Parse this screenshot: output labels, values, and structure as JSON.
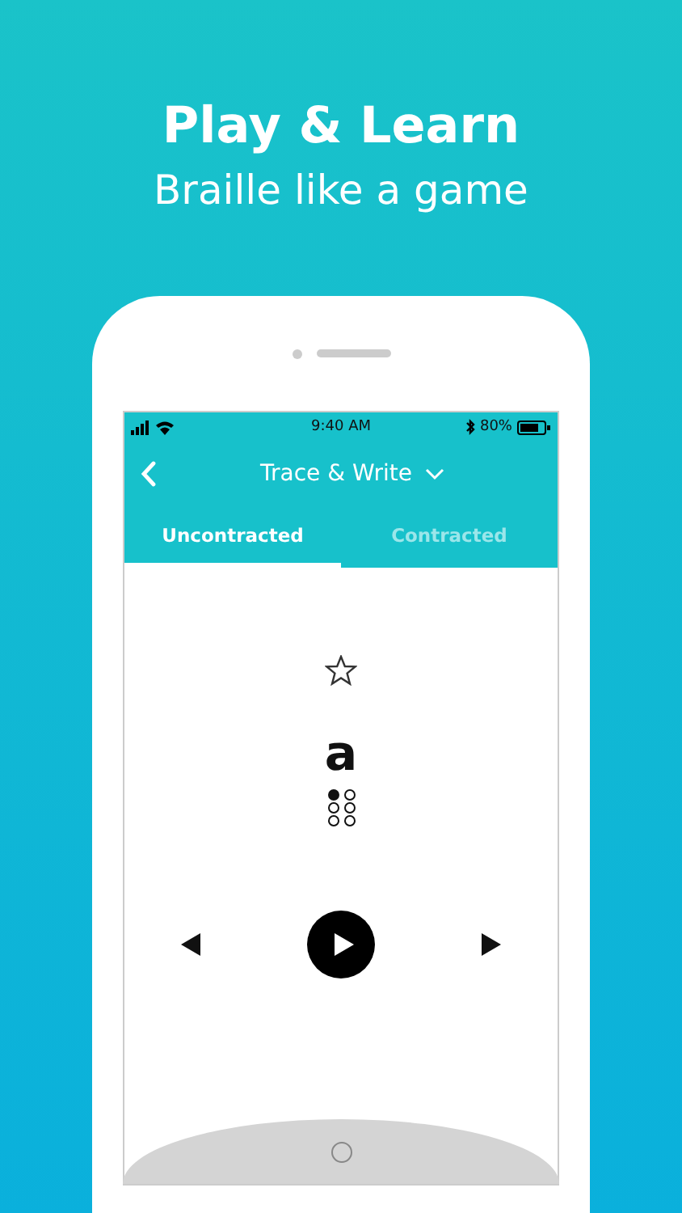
{
  "headline": {
    "title": "Play & Learn",
    "subtitle": "Braille like a game"
  },
  "status_bar": {
    "time": "9:40 AM",
    "battery": "80%"
  },
  "header": {
    "title": "Trace & Write"
  },
  "tabs": [
    {
      "label": "Uncontracted",
      "selected": true
    },
    {
      "label": "Contracted",
      "selected": false
    }
  ],
  "card": {
    "starred": false,
    "letter": "a",
    "dots": [
      true,
      false,
      false,
      false,
      false,
      false
    ]
  }
}
